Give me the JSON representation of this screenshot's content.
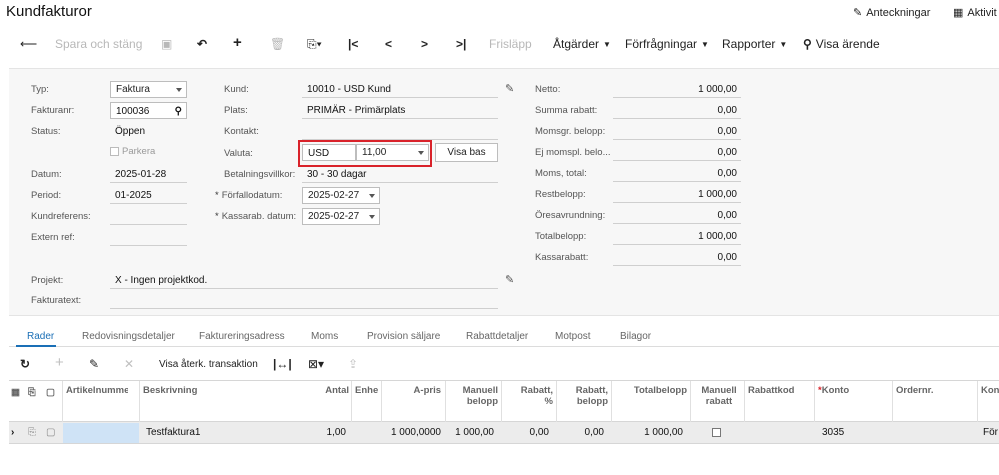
{
  "header": {
    "title": "Kundfakturor",
    "notes_label": "Anteckningar",
    "activities_label": "Aktivit"
  },
  "toolbar": {
    "save_close": "Spara och stäng",
    "release": "Frisläpp",
    "actions": "Åtgärder",
    "inquiries": "Förfrågningar",
    "reports": "Rapporter",
    "show_document": "Visa ärende"
  },
  "form": {
    "type_label": "Typ:",
    "type_value": "Faktura",
    "invoice_no_label": "Fakturanr:",
    "invoice_no_value": "100036",
    "status_label": "Status:",
    "status_value": "Öppen",
    "hold_label": "Parkera",
    "date_label": "Datum:",
    "date_value": "2025-01-28",
    "period_label": "Period:",
    "period_value": "01-2025",
    "customer_ref_label": "Kundreferens:",
    "external_ref_label": "Extern ref:",
    "project_label": "Projekt:",
    "project_value": "X - Ingen projektkod.",
    "invoice_text_label": "Fakturatext:",
    "customer_label": "Kund:",
    "customer_value": "10010 - USD Kund",
    "location_label": "Plats:",
    "location_value": "PRIMÄR - Primärplats",
    "contact_label": "Kontakt:",
    "currency_label": "Valuta:",
    "currency_value": "USD",
    "rate_value": "11,00",
    "show_base_label": "Visa bas",
    "terms_label": "Betalningsvillkor:",
    "terms_value": "30 - 30 dagar",
    "due_date_label": "Förfallodatum:",
    "due_date_value": "2025-02-27",
    "cash_disc_date_label": "Kassarab. datum:",
    "cash_disc_date_value": "2025-02-27",
    "summary": [
      {
        "label": "Netto:",
        "value": "1 000,00"
      },
      {
        "label": "Summa rabatt:",
        "value": "0,00"
      },
      {
        "label": "Momsgr. belopp:",
        "value": "0,00"
      },
      {
        "label": "Ej momspl. belo...",
        "value": "0,00"
      },
      {
        "label": "Moms, total:",
        "value": "0,00"
      },
      {
        "label": "Restbelopp:",
        "value": "1 000,00"
      },
      {
        "label": "Öresavrundning:",
        "value": "0,00"
      },
      {
        "label": "Totalbelopp:",
        "value": "1 000,00"
      },
      {
        "label": "Kassarabatt:",
        "value": "0,00"
      }
    ]
  },
  "tabs": [
    "Rader",
    "Redovisningsdetaljer",
    "Faktureringsadress",
    "Moms",
    "Provision säljare",
    "Rabattdetaljer",
    "Motpost",
    "Bilagor"
  ],
  "grid": {
    "show_transaction_label": "Visa återk. transaktion",
    "columns": {
      "item": "Artikelnumme",
      "desc": "Beskrivning",
      "qty": "Antal",
      "unit": "Enhe",
      "price": "A-pris",
      "manual_amount_1": "Manuell",
      "manual_amount_2": "belopp",
      "disc_pct_1": "Rabatt,",
      "disc_pct_2": "%",
      "disc_amt_1": "Rabatt,",
      "disc_amt_2": "belopp",
      "total": "Totalbelopp",
      "manual_disc_1": "Manuell",
      "manual_disc_2": "rabatt",
      "disc_code": "Rabattkod",
      "account": "Konto",
      "order_no": "Ordernr.",
      "more": "Kon"
    },
    "row": {
      "desc": "Testfaktura1",
      "qty": "1,00",
      "price": "1 000,0000",
      "manual_amount": "1 000,00",
      "disc_pct": "0,00",
      "disc_amt": "0,00",
      "total": "1 000,00",
      "account": "3035",
      "more": "För"
    }
  }
}
